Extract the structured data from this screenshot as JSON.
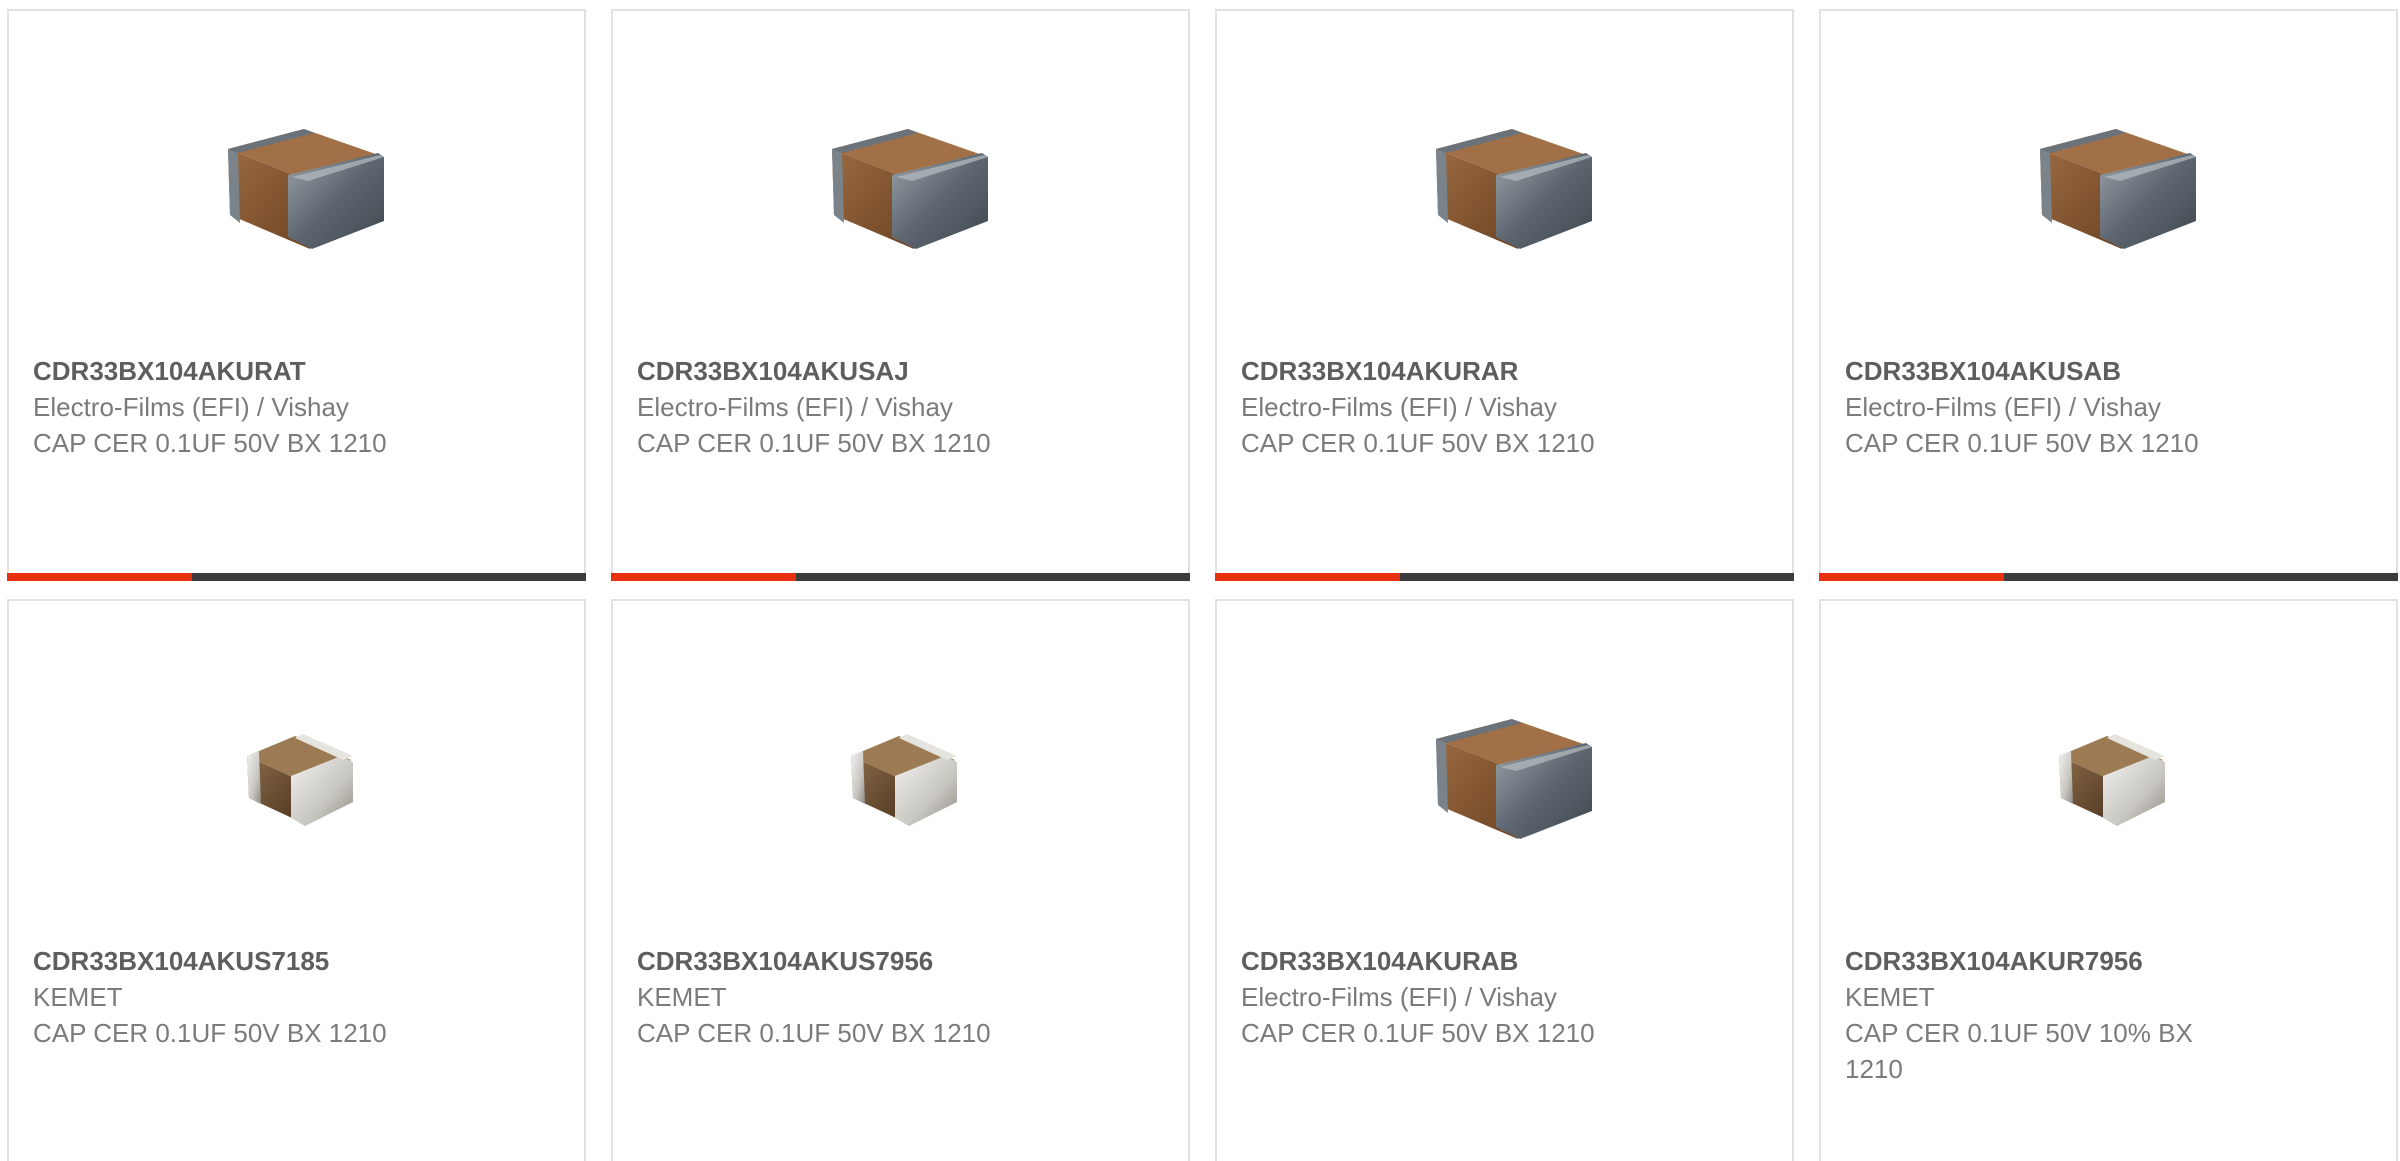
{
  "accent_color": "#e8320f",
  "track_color": "#3c3c3c",
  "products": [
    {
      "part": "CDR33BX104AKURAT",
      "manufacturer": "Electro-Films (EFI) / Vishay",
      "description": "CAP CER 0.1UF 50V BX 1210",
      "image_icon": "large-chip-capacitor-icon",
      "progress_fraction": 0.32
    },
    {
      "part": "CDR33BX104AKUSAJ",
      "manufacturer": "Electro-Films (EFI) / Vishay",
      "description": "CAP CER 0.1UF 50V BX 1210",
      "image_icon": "large-chip-capacitor-icon",
      "progress_fraction": 0.32
    },
    {
      "part": "CDR33BX104AKURAR",
      "manufacturer": "Electro-Films (EFI) / Vishay",
      "description": "CAP CER 0.1UF 50V BX 1210",
      "image_icon": "large-chip-capacitor-icon",
      "progress_fraction": 0.32
    },
    {
      "part": "CDR33BX104AKUSAB",
      "manufacturer": "Electro-Films (EFI) / Vishay",
      "description": "CAP CER 0.1UF 50V BX 1210",
      "image_icon": "large-chip-capacitor-icon",
      "progress_fraction": 0.32
    },
    {
      "part": "CDR33BX104AKUS7185",
      "manufacturer": "KEMET",
      "description": "CAP CER 0.1UF 50V BX 1210",
      "image_icon": "small-chip-capacitor-icon"
    },
    {
      "part": "CDR33BX104AKUS7956",
      "manufacturer": "KEMET",
      "description": "CAP CER 0.1UF 50V BX 1210",
      "image_icon": "small-chip-capacitor-icon"
    },
    {
      "part": "CDR33BX104AKURAB",
      "manufacturer": "Electro-Films (EFI) / Vishay",
      "description": "CAP CER 0.1UF 50V BX 1210",
      "image_icon": "large-chip-capacitor-icon"
    },
    {
      "part": "CDR33BX104AKUR7956",
      "manufacturer": "KEMET",
      "description": "CAP CER 0.1UF 50V 10% BX 1210",
      "image_icon": "small-chip-capacitor-icon"
    }
  ]
}
